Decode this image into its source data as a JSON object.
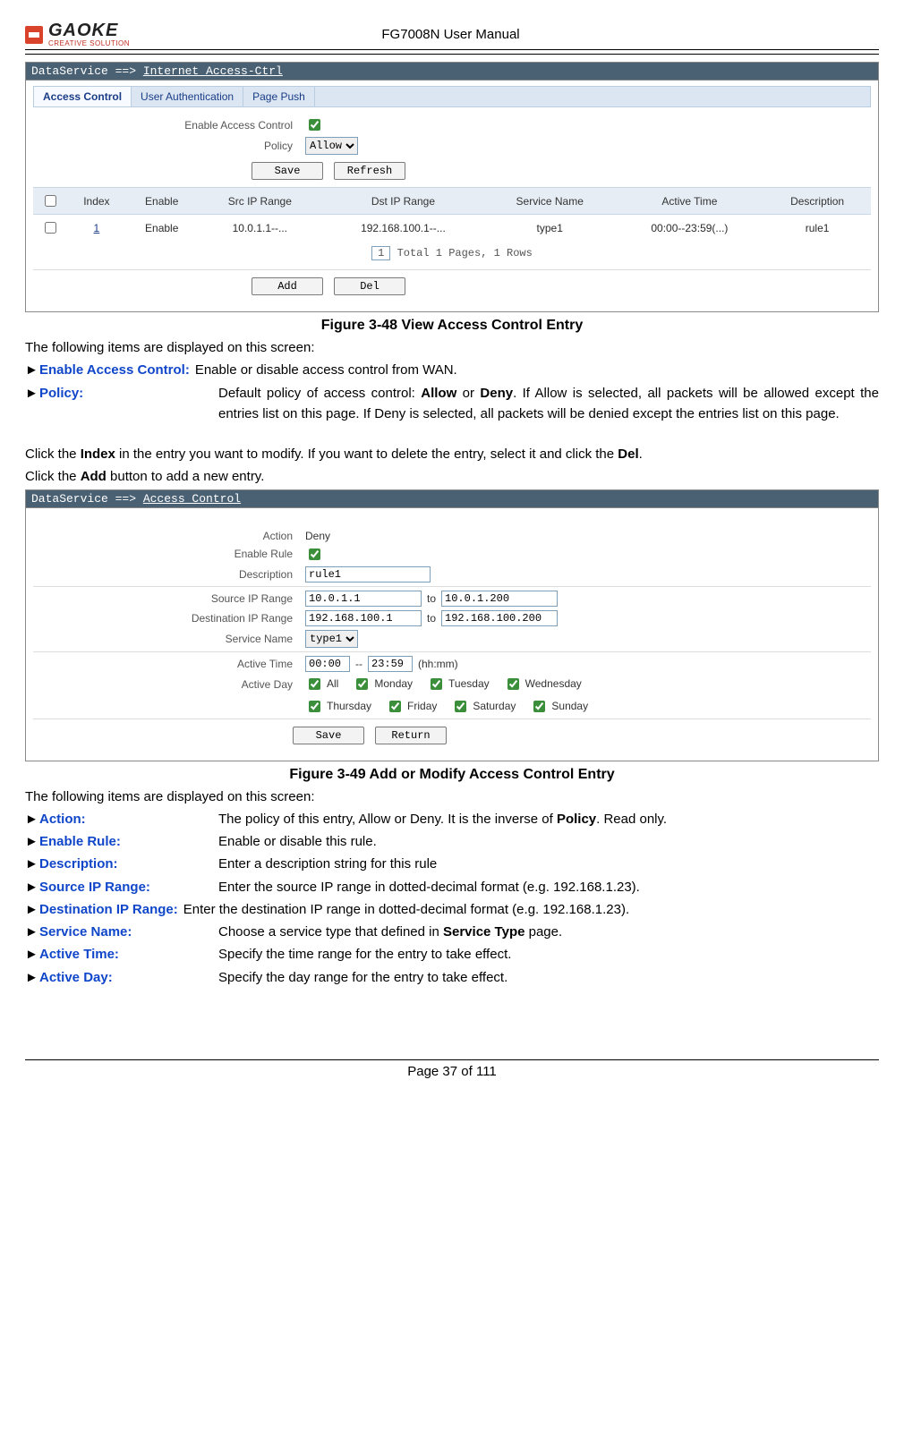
{
  "header": {
    "logo_text": "GAOKE",
    "logo_sub": "CREATIVE SOLUTION",
    "doc_title": "FG7008N User Manual"
  },
  "panel1": {
    "title_prefix": "DataService ==> ",
    "title_main": "Internet Access-Ctrl",
    "tabs": {
      "t1": "Access Control",
      "t2": "User Authentication",
      "t3": "Page Push"
    },
    "enable_label": "Enable Access Control",
    "policy_label": "Policy",
    "policy_value": "Allow",
    "save": "Save",
    "refresh": "Refresh",
    "th": {
      "sel": "",
      "index": "Index",
      "enable": "Enable",
      "src": "Src IP Range",
      "dst": "Dst IP Range",
      "svc": "Service Name",
      "active": "Active Time",
      "desc": "Description"
    },
    "row": {
      "index": "1",
      "enable": "Enable",
      "src": "10.0.1.1--...",
      "dst": "192.168.100.1--...",
      "svc": "type1",
      "active": "00:00--23:59(...)",
      "desc": "rule1"
    },
    "pager_box": "1",
    "pager_text": "Total 1 Pages, 1 Rows",
    "add": "Add",
    "del": "Del"
  },
  "fig1": "Figure 3-48   View Access Control Entry",
  "section1": {
    "intro": "The following items are displayed on this screen:",
    "l1_label": "Enable Access Control:",
    "l1_text": "Enable or disable access control from WAN.",
    "l2_label": "Policy:",
    "l2_text_a": "Default policy of access control: ",
    "l2_allow": "Allow",
    "l2_text_b": " or ",
    "l2_deny": "Deny",
    "l2_text_c": ". If Allow is selected, all packets will be allowed except the entries list on this page. If Deny is selected, all packets will be denied except the entries list on this page."
  },
  "mid_para_a": "Click the ",
  "mid_para_b": "Index",
  "mid_para_c": " in the entry you want to modify. If you want to delete the entry, select it and click the ",
  "mid_para_d": "Del",
  "mid_para_e": ".",
  "mid_para2_a": "Click the ",
  "mid_para2_b": "Add",
  "mid_para2_c": " button to add a new entry.",
  "panel2": {
    "title_prefix": "DataService ==> ",
    "title_main": "Access Control",
    "action_label": "Action",
    "action_value": "Deny",
    "enable_label": "Enable Rule",
    "desc_label": "Description",
    "desc_value": "rule1",
    "src_label": "Source IP Range",
    "src_from": "10.0.1.1",
    "src_to": "10.0.1.200",
    "dst_label": "Destination IP Range",
    "dst_from": "192.168.100.1",
    "dst_to": "192.168.100.200",
    "svc_label": "Service Name",
    "svc_value": "type1",
    "time_label": "Active Time",
    "time_from": "00:00",
    "time_to": "23:59",
    "time_hint": "(hh:mm)",
    "to_word": "to",
    "sep": "--",
    "day_label": "Active Day",
    "days": {
      "all": "All",
      "mon": "Monday",
      "tue": "Tuesday",
      "wed": "Wednesday",
      "thu": "Thursday",
      "fri": "Friday",
      "sat": "Saturday",
      "sun": "Sunday"
    },
    "save": "Save",
    "return": "Return"
  },
  "fig2": "Figure 3-49   Add or Modify Access Control Entry",
  "section2": {
    "intro": "The following items are displayed on this screen:",
    "i1_label": "Action:",
    "i1_text_a": "The policy of this entry, Allow or Deny. It is the inverse of ",
    "i1_text_b": "Policy",
    "i1_text_c": ". Read only.",
    "i2_label": "Enable Rule:",
    "i2_text": "Enable or disable this rule.",
    "i3_label": "Description:",
    "i3_text": "Enter a description string for this rule",
    "i4_label": "Source IP Range:",
    "i4_text": "Enter the source IP range in dotted-decimal format (e.g. 192.168.1.23).",
    "i5_label": "Destination IP Range:",
    "i5_text": "Enter the destination IP range in dotted-decimal format (e.g. 192.168.1.23).",
    "i6_label": "Service Name:",
    "i6_text_a": "Choose a service type that defined in ",
    "i6_text_b": "Service Type",
    "i6_text_c": " page.",
    "i7_label": "Active Time:",
    "i7_text": "Specify the time range for the entry to take effect.",
    "i8_label": "Active Day:",
    "i8_text": "Specify the day range for the entry to take effect."
  },
  "footer": "Page 37 of 111"
}
